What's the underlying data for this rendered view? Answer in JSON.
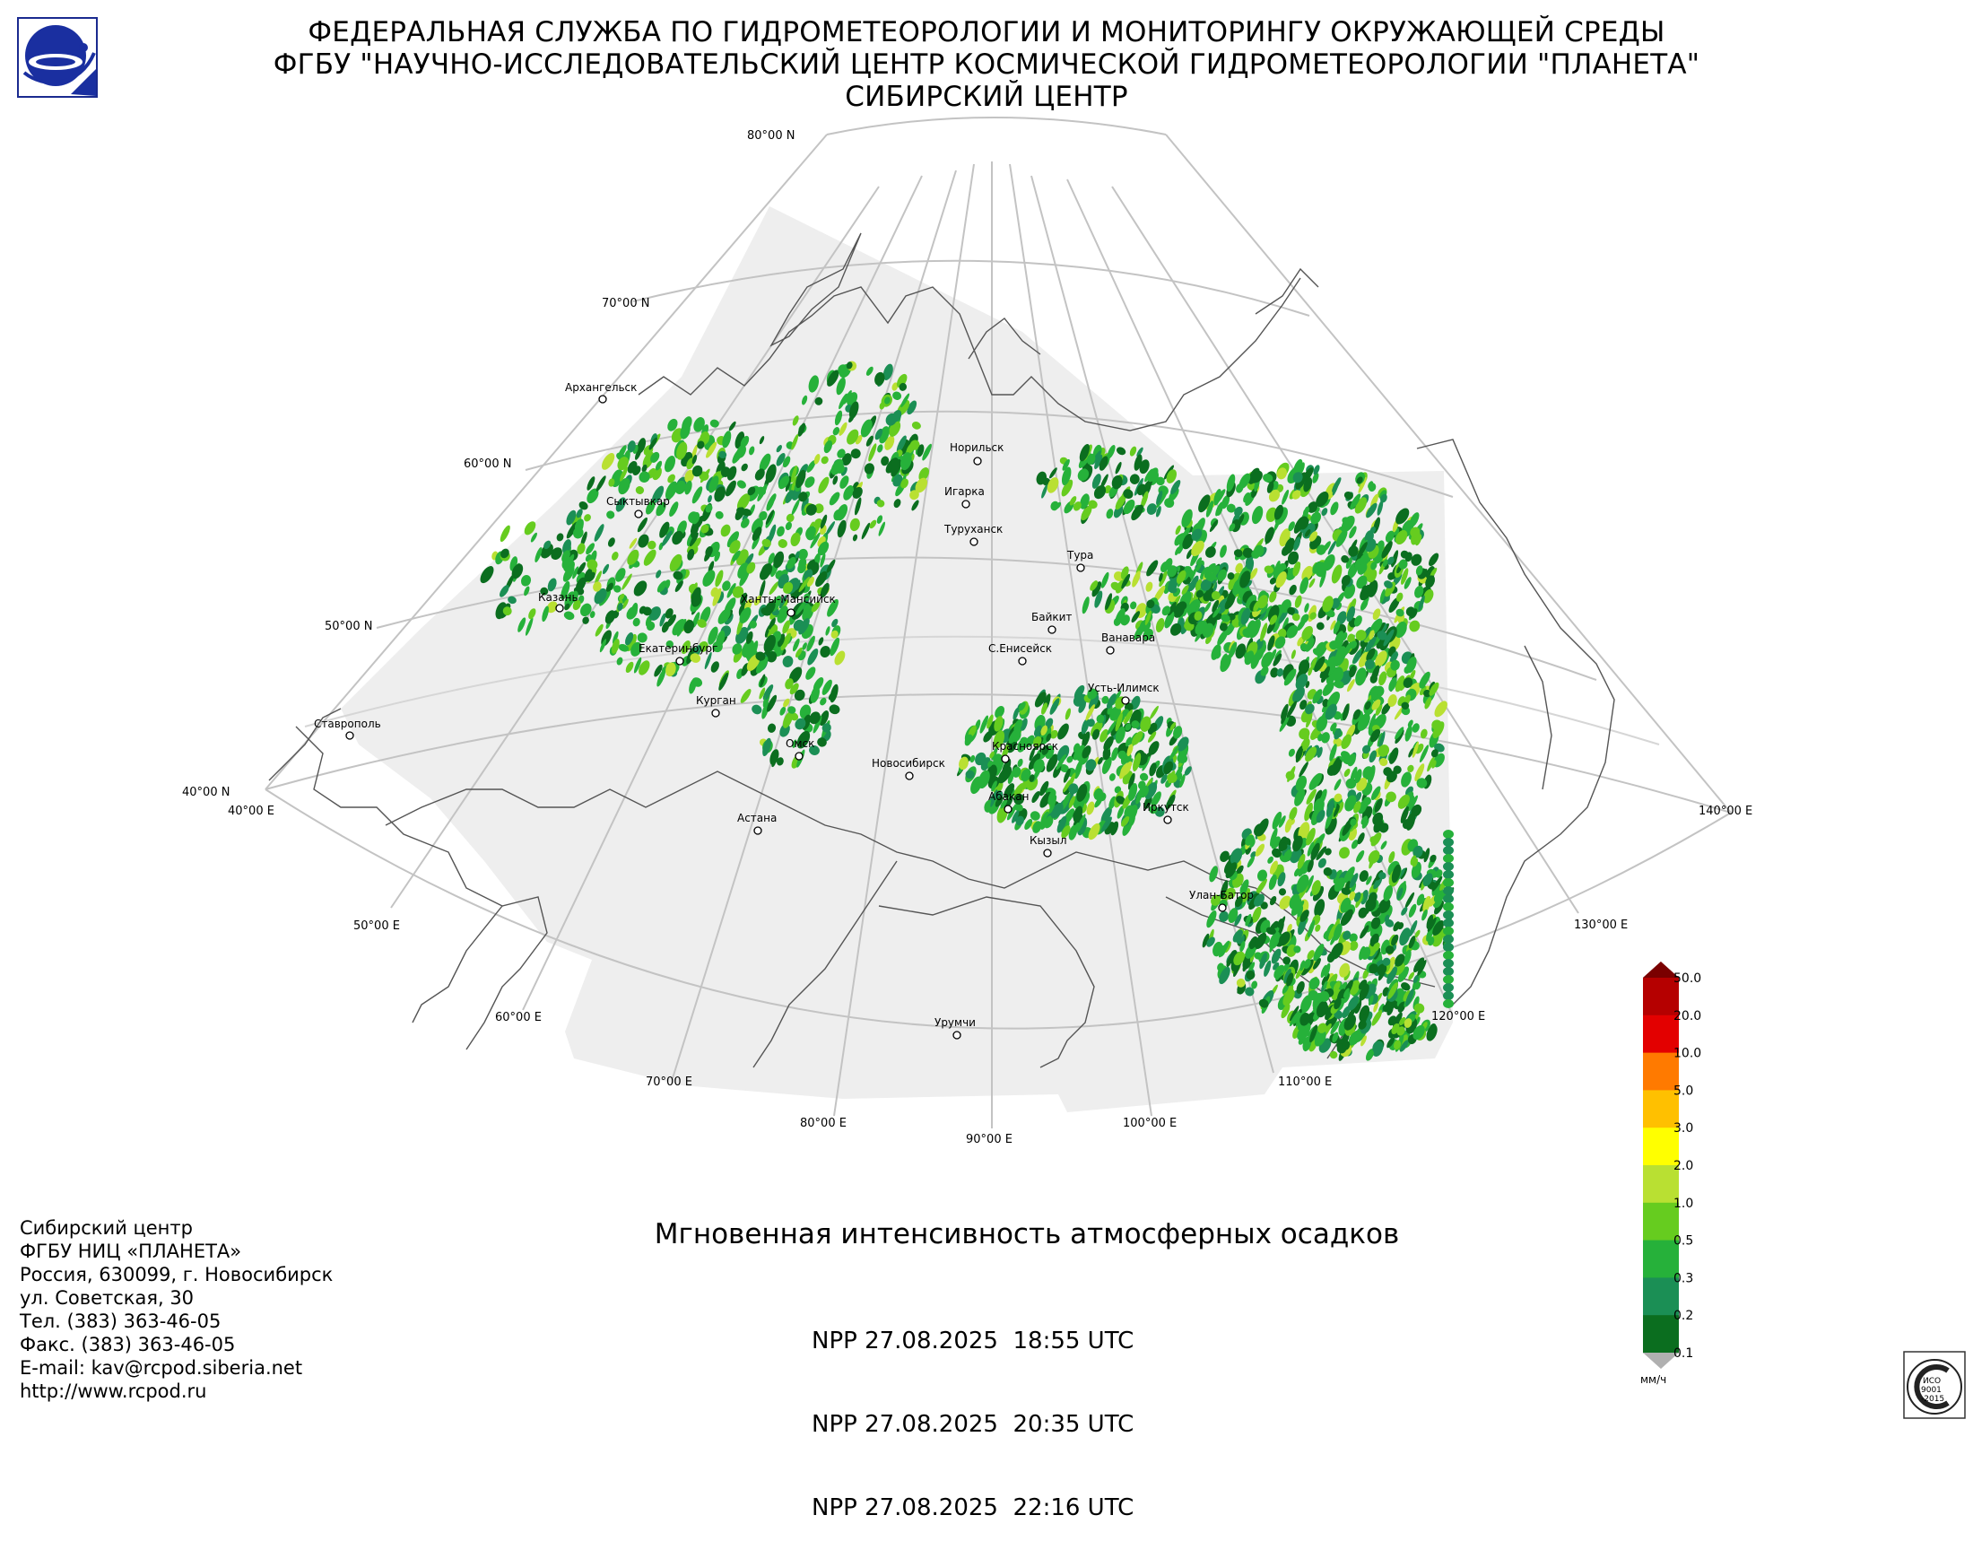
{
  "header": {
    "line1": "ФЕДЕРАЛЬНАЯ СЛУЖБА ПО ГИДРОМЕТЕОРОЛОГИИ И МОНИТОРИНГУ ОКРУЖАЮЩЕЙ СРЕДЫ",
    "line2": "ФГБУ \"НАУЧНО-ИССЛЕДОВАТЕЛЬСКИЙ ЦЕНТР КОСМИЧЕСКОЙ ГИДРОМЕТЕОРОЛОГИИ \"ПЛАНЕТА\"",
    "line3": "СИБИРСКИЙ ЦЕНТР"
  },
  "map": {
    "lat_labels": [
      "80°00 N",
      "70°00 N",
      "60°00 N",
      "50°00 N",
      "40°00 N"
    ],
    "lon_labels": [
      "40°00 E",
      "50°00 E",
      "60°00 E",
      "70°00 E",
      "80°00 E",
      "90°00 E",
      "100°00 E",
      "110°00 E",
      "120°00 E",
      "130°00 E",
      "140°00 E"
    ],
    "cities": [
      "Архангельск",
      "Сыктывкар",
      "Казань",
      "Ханты-Мансийск",
      "Екатеринбург",
      "Курган",
      "Ставрополь",
      "Омск",
      "Новосибирск",
      "Астана",
      "Норильск",
      "Игарка",
      "Туруханск",
      "Тура",
      "Байкит",
      "Ванавара",
      "С.Енисейск",
      "Усть-Илимск",
      "Красноярск",
      "Абакан",
      "Кызыл",
      "Иркутск",
      "Улан-Батор",
      "Урумчи"
    ],
    "precipitation_regions": [
      "western-siberia-ural",
      "central-siberia",
      "eastern-siberia-baikal",
      "mongolia-transbaikalia"
    ]
  },
  "legend": {
    "ticks": [
      "50.0",
      "20.0",
      "10.0",
      "5.0",
      "3.0",
      "2.0",
      "1.0",
      "0.5",
      "0.3",
      "0.2",
      "0.1"
    ],
    "unit": "мм/ч",
    "colors": [
      "#b50000",
      "#e30000",
      "#ff7a00",
      "#ffc000",
      "#ffff00",
      "#b9e032",
      "#66cc1f",
      "#26b13a",
      "#1b8f55",
      "#0b6e1f"
    ],
    "max_arrow_color": "#7a0000",
    "min_arrow_color": "#b0b0b0"
  },
  "title": "Мгновенная интенсивность атмосферных осадков",
  "passes": [
    {
      "sat": "NPP",
      "date": "27.08.2025",
      "time": "18:55 UTC"
    },
    {
      "sat": "NPP",
      "date": "27.08.2025",
      "time": "20:35 UTC"
    },
    {
      "sat": "NPP",
      "date": "27.08.2025",
      "time": "22:16 UTC"
    }
  ],
  "contact": [
    "Сибирский центр",
    "ФГБУ НИЦ «ПЛАНЕТА»",
    "Россия, 630099, г. Новосибирск",
    "ул. Советская, 30",
    "Тел. (383) 363-46-05",
    "Факс. (383) 363-46-05",
    "E-mail: kav@rcpod.siberia.net",
    "http://www.rcpod.ru"
  ],
  "iso": {
    "line1": "ИСО",
    "line2": "9001",
    "line3": "-2015"
  }
}
